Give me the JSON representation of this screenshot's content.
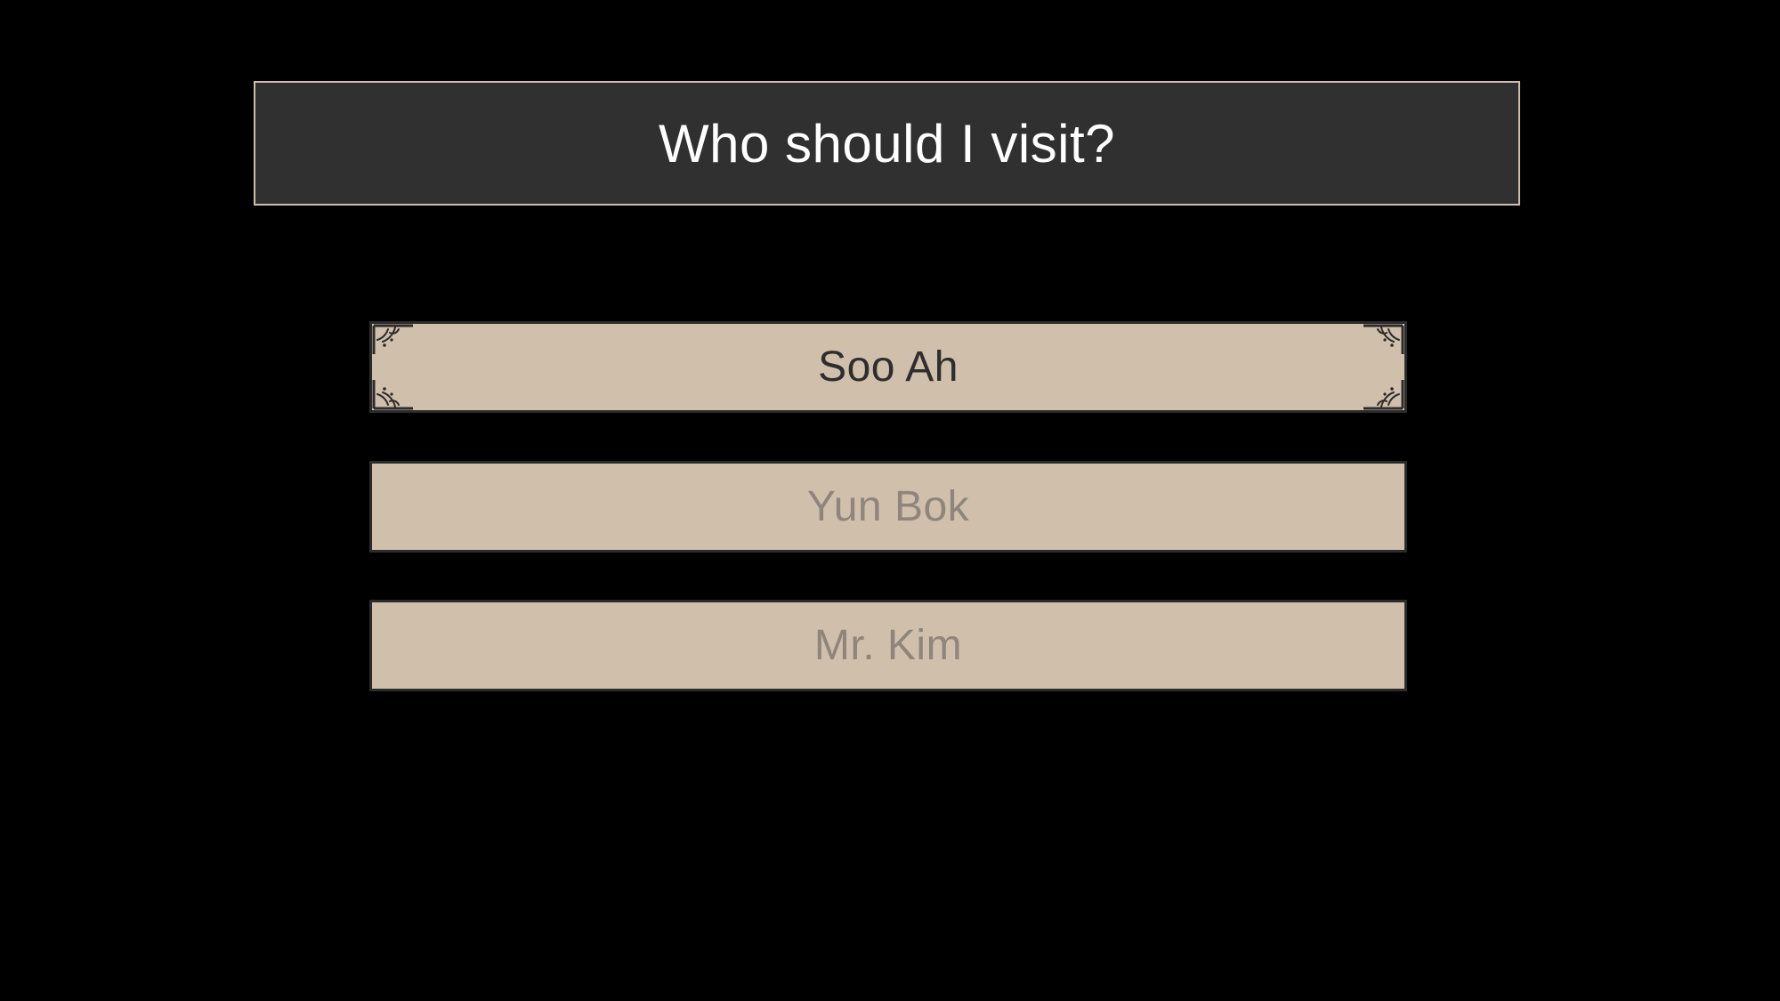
{
  "prompt": {
    "text": "Who should I visit?"
  },
  "choices": [
    {
      "label": "Soo Ah",
      "state": "selected"
    },
    {
      "label": "Yun Bok",
      "state": "unselected"
    },
    {
      "label": "Mr. Kim",
      "state": "unselected"
    }
  ],
  "colors": {
    "background": "#000000",
    "prompt_box": "#303030",
    "prompt_border": "#cfc0aa",
    "choice_fill": "#d0bfab",
    "choice_border": "#2b2b2b",
    "selected_text": "#2e2e2e",
    "dim_text": "#8e857b"
  },
  "icons": {
    "selected_corner": "floral-corner-ornament"
  }
}
